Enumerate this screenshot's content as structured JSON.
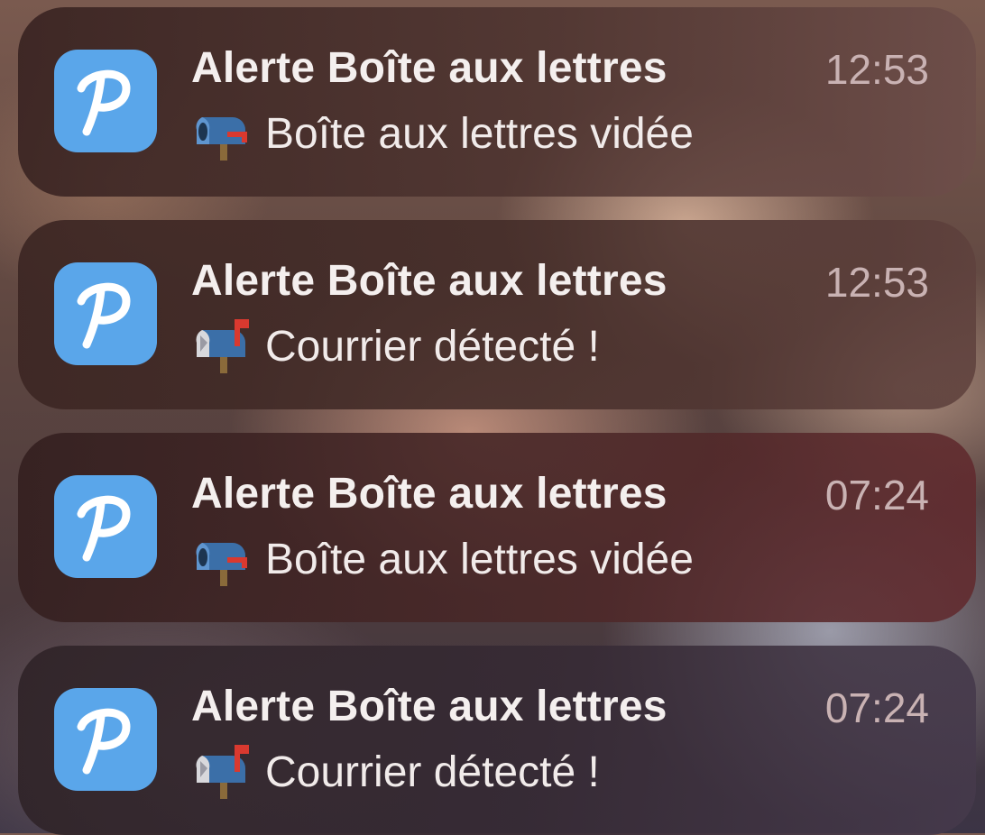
{
  "notifications": [
    {
      "app_icon": "p-logo-icon",
      "title": "Alerte Boîte aux lettres",
      "time": "12:53",
      "emoji_icon": "mailbox-lowered-flag-icon",
      "message": "Boîte aux lettres vidée"
    },
    {
      "app_icon": "p-logo-icon",
      "title": "Alerte Boîte aux lettres",
      "time": "12:53",
      "emoji_icon": "mailbox-raised-flag-icon",
      "message": "Courrier détecté !"
    },
    {
      "app_icon": "p-logo-icon",
      "title": "Alerte Boîte aux lettres",
      "time": "07:24",
      "emoji_icon": "mailbox-lowered-flag-icon",
      "message": "Boîte aux lettres vidée"
    },
    {
      "app_icon": "p-logo-icon",
      "title": "Alerte Boîte aux lettres",
      "time": "07:24",
      "emoji_icon": "mailbox-raised-flag-icon",
      "message": "Courrier détecté !"
    }
  ],
  "colors": {
    "app_icon_background": "#5aa6ea",
    "title_text": "#f4efee",
    "time_text": "#c9b2b3",
    "mailbox_flag": "#d9392f"
  }
}
